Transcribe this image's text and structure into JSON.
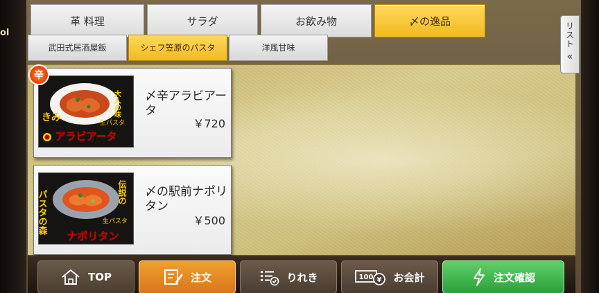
{
  "bezel": {
    "left_text": "ol"
  },
  "category_tabs": [
    {
      "label": "革 料理",
      "active": false
    },
    {
      "label": "サラダ",
      "active": false
    },
    {
      "label": "お飲み物",
      "active": false
    },
    {
      "label": "〆の逸品",
      "active": true
    }
  ],
  "sub_tabs": [
    {
      "label": "武田式居酒屋飯",
      "active": false
    },
    {
      "label": "シェフ笠原のパスタ",
      "active": true
    },
    {
      "label": "洋風甘味",
      "active": false
    }
  ],
  "list_toggle": {
    "label": "リスト",
    "chevron": "«"
  },
  "items": [
    {
      "name": "〆辛アラビアータ",
      "price": "￥720",
      "image": {
        "badge": "辛",
        "caption_main": "アラビアータ",
        "caption_side": "大人の味",
        "caption_left": "きみ",
        "caption_tag": "生パスタ"
      }
    },
    {
      "name": "〆の駅前ナポリタン",
      "price": "￥500",
      "image": {
        "caption_main": "ナポリタン",
        "caption_left": "パスタの森",
        "caption_side": "伝説の",
        "caption_tag": "生パスタ"
      }
    }
  ],
  "bottom_bar": {
    "top": {
      "label": "TOP",
      "icon": "home-icon"
    },
    "order": {
      "label": "注文",
      "icon": "pencil-note-icon"
    },
    "history": {
      "label": "りれき",
      "icon": "history-list-icon"
    },
    "checkout": {
      "label": "お会計",
      "icon": "cash-icon",
      "icon_text": "100"
    },
    "confirm": {
      "label": "注文確認",
      "icon": "lightning-icon"
    }
  },
  "colors": {
    "active_tab": "#f2b922",
    "order_button": "#d9761a",
    "confirm_button": "#2aa03a"
  }
}
